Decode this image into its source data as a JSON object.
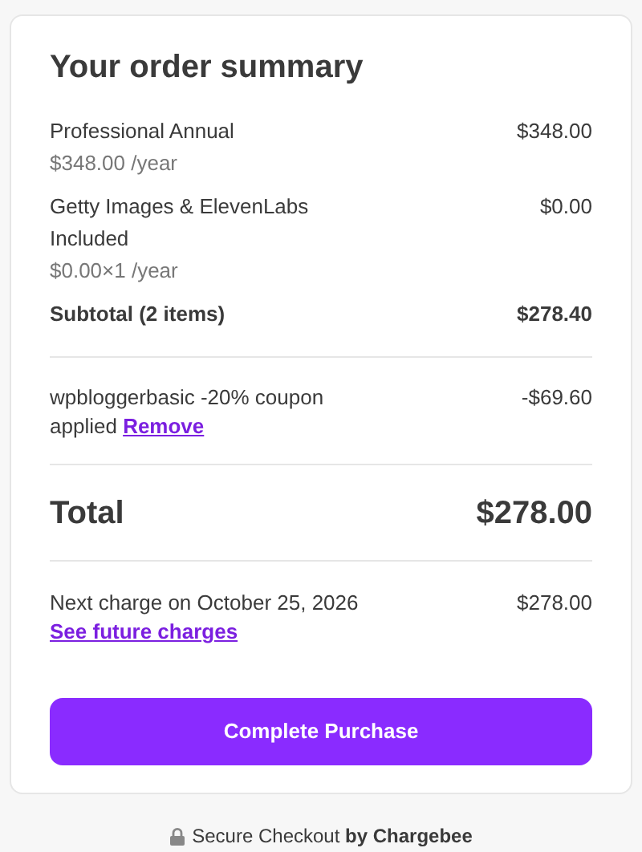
{
  "title": "Your order summary",
  "items": [
    {
      "name": "Professional Annual",
      "price": "$348.00",
      "detail": "$348.00 /year"
    },
    {
      "name": "Getty Images & ElevenLabs Included",
      "price": "$0.00",
      "detail": "$0.00×1 /year"
    }
  ],
  "subtotal": {
    "label": "Subtotal (2 items)",
    "value": "$278.40"
  },
  "coupon": {
    "text": "wpbloggerbasic -20% coupon applied",
    "link": "Remove",
    "value": "-$69.60"
  },
  "total": {
    "label": "Total",
    "value": "$278.00"
  },
  "next_charge": {
    "text": "Next charge on October 25, 2026",
    "value": "$278.00",
    "link": "See future charges"
  },
  "button": "Complete Purchase",
  "footer": "Secure Checkout **by Chargebee**"
}
